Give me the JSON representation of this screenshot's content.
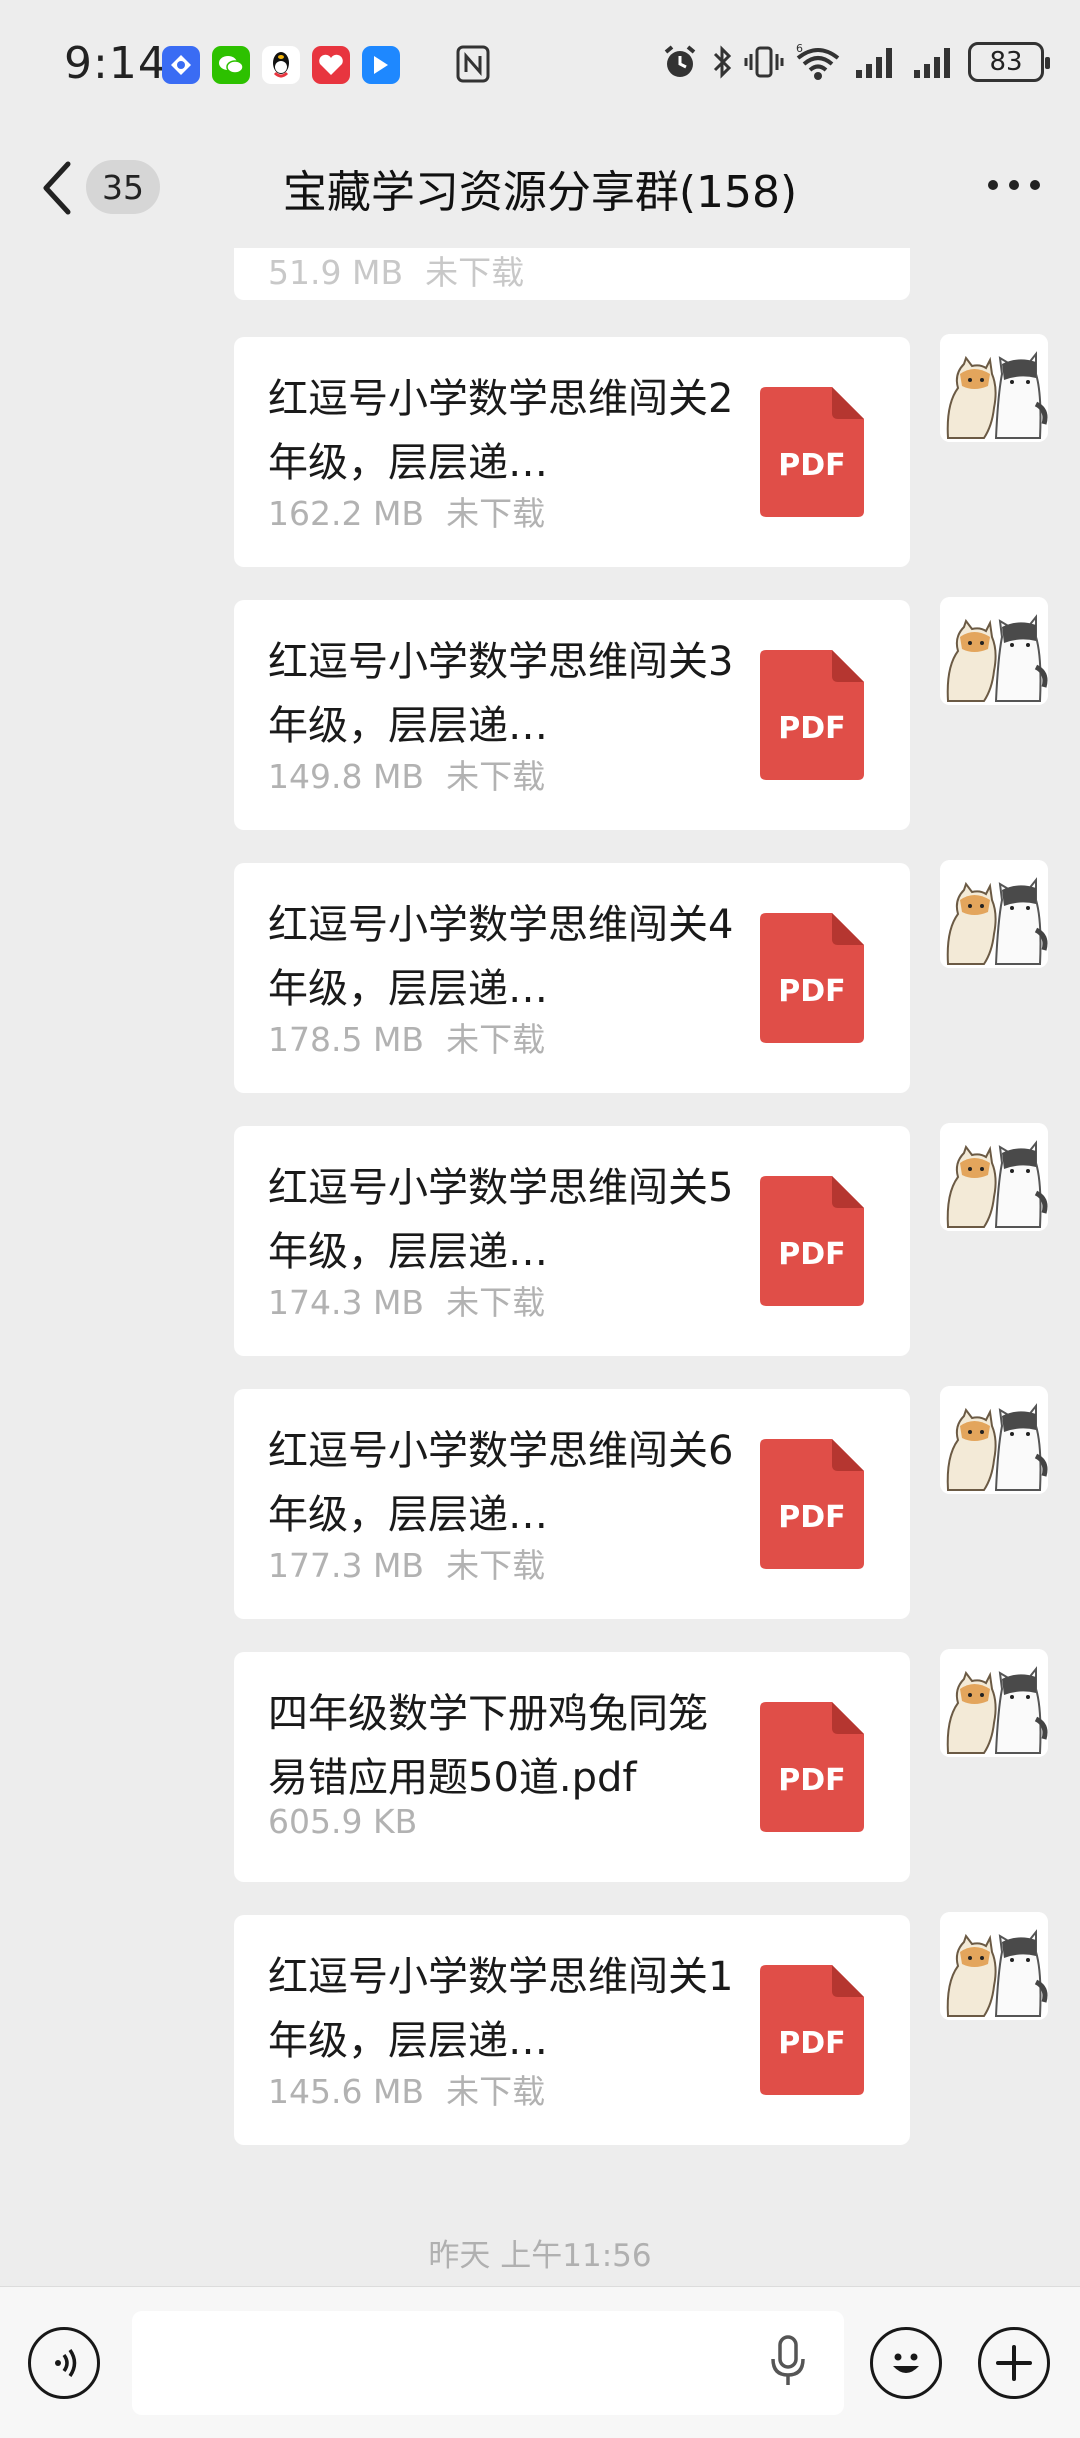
{
  "status_bar": {
    "time": "9:14",
    "battery": "83",
    "app_icons": [
      {
        "name": "baidu-netdisk-icon",
        "color": "#3a6cf4"
      },
      {
        "name": "wechat-icon",
        "color": "#2dc100"
      },
      {
        "name": "qq-icon",
        "color": "#ffffff"
      },
      {
        "name": "xiaohongshu-icon",
        "color": "#e8353f"
      },
      {
        "name": "tencent-meeting-icon",
        "color": "#1e88ff"
      }
    ]
  },
  "nav": {
    "back_badge": "35",
    "title": "宝藏学习资源分享群(158)"
  },
  "partial_message": {
    "size": "51.9 MB",
    "status": "未下载"
  },
  "messages": [
    {
      "filename": "红逗号小学数学思维闯关2年级，层层递…",
      "size": "162.2 MB",
      "status": "未下载",
      "icon_label": "PDF"
    },
    {
      "filename": "红逗号小学数学思维闯关3年级，层层递…",
      "size": "149.8 MB",
      "status": "未下载",
      "icon_label": "PDF"
    },
    {
      "filename": "红逗号小学数学思维闯关4年级，层层递…",
      "size": "178.5 MB",
      "status": "未下载",
      "icon_label": "PDF"
    },
    {
      "filename": "红逗号小学数学思维闯关5年级，层层递…",
      "size": "174.3 MB",
      "status": "未下载",
      "icon_label": "PDF"
    },
    {
      "filename": "红逗号小学数学思维闯关6年级，层层递…",
      "size": "177.3 MB",
      "status": "未下载",
      "icon_label": "PDF"
    },
    {
      "filename": "四年级数学下册鸡兔同笼易错应用题50道.pdf",
      "size": "605.9 KB",
      "status": "",
      "icon_label": "PDF"
    },
    {
      "filename": "红逗号小学数学思维闯关1年级，层层递…",
      "size": "145.6 MB",
      "status": "未下载",
      "icon_label": "PDF"
    }
  ],
  "timestamp": "昨天 上午11:56",
  "colors": {
    "background": "#ededed",
    "bubble": "#ffffff",
    "pdf_red": "#e04e48",
    "meta_gray": "#b2b2b2"
  }
}
